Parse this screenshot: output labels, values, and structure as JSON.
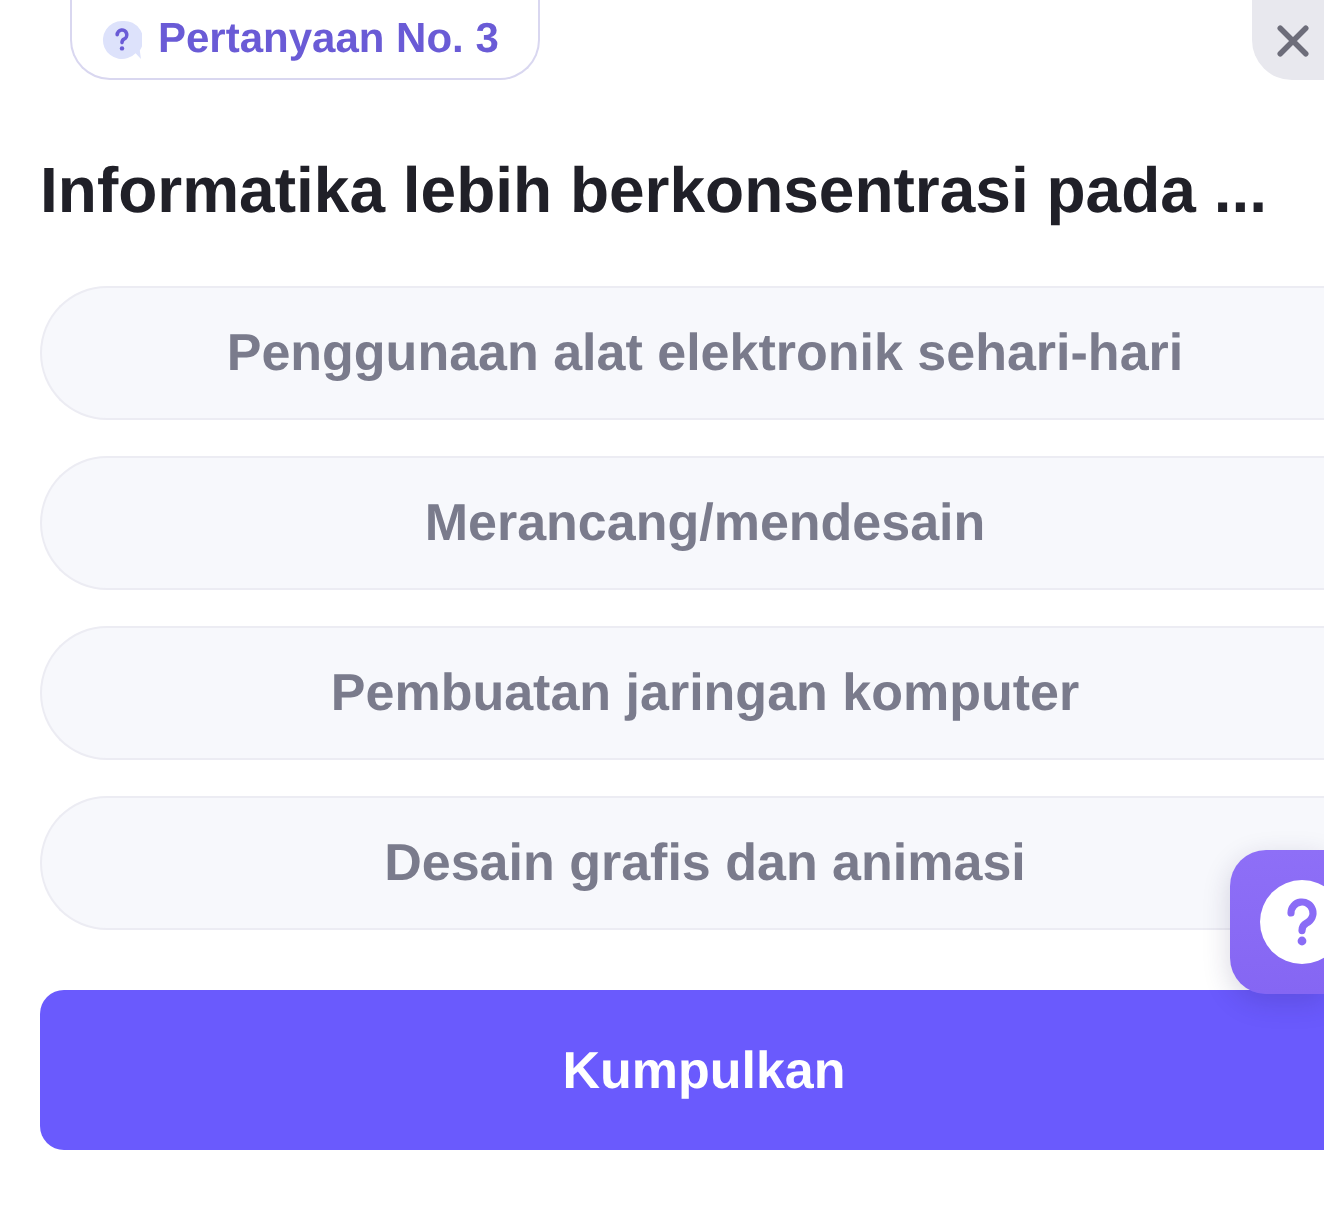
{
  "badge": {
    "label": "Pertanyaan No. 3"
  },
  "question": {
    "text": "Informatika lebih berkonsentrasi pada ..."
  },
  "options": [
    {
      "label": "Penggunaan alat elektronik sehari-hari",
      "selected": false
    },
    {
      "label": "Merancang/mendesain",
      "selected": false
    },
    {
      "label": "Pembuatan jaringan komputer",
      "selected": false
    },
    {
      "label": "Desain grafis dan animasi",
      "selected": false
    }
  ],
  "submit_button": {
    "label": "Kumpulkan"
  }
}
